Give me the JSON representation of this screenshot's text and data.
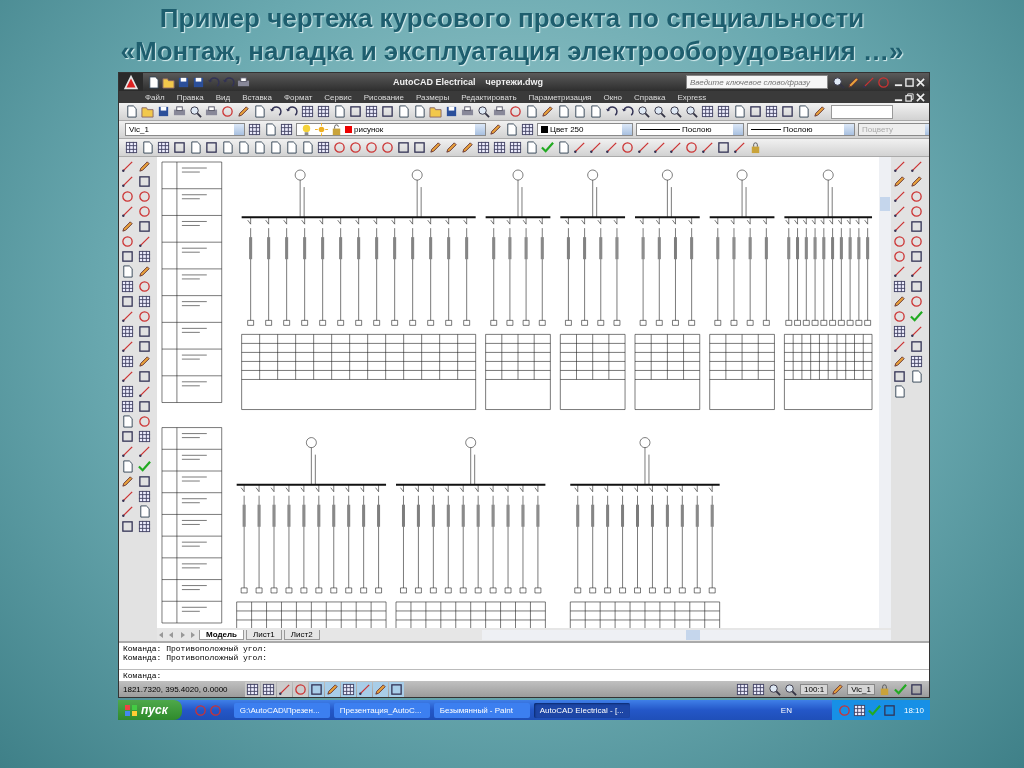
{
  "slide": {
    "title_lines": [
      "Пример чертежа курсового проекта по специальности",
      "«Монтаж, наладка и эксплуатация электрооборудования …»"
    ]
  },
  "window": {
    "app": "AutoCAD Electrical",
    "document": "чертежи.dwg",
    "search": {
      "placeholder": "Введите ключевое слово/фразу"
    }
  },
  "menu": [
    "Файл",
    "Правка",
    "Вид",
    "Вставка",
    "Формат",
    "Сервис",
    "Рисование",
    "Размеры",
    "Редактировать",
    "Параметризация",
    "Окно",
    "Справка",
    "Express"
  ],
  "layer_toolbar": {
    "view": "Vic_1",
    "layer": "рисунок",
    "color_setting": "Цвет 250",
    "linetype": "Послою",
    "lineweight": "Послою",
    "plotstyle": {
      "value": "Поцвету",
      "disabled": true
    }
  },
  "layout_tabs": [
    {
      "label": "Модель",
      "selected": true
    },
    {
      "label": "Лист1",
      "selected": false
    },
    {
      "label": "Лист2",
      "selected": false
    }
  ],
  "command_history": [
    "Команда: Противоположный угол:",
    "Команда: Противоположный угол:"
  ],
  "command_prompt": "Команда:",
  "status_bar": {
    "coordinates": "1821.7320, 395.4020, 0.0000",
    "toggles": [
      {
        "on": false
      },
      {
        "on": false
      },
      {
        "on": false
      },
      {
        "on": false
      },
      {
        "on": true
      },
      {
        "on": true
      },
      {
        "on": true
      },
      {
        "on": true
      },
      {
        "on": true
      },
      {
        "on": true
      }
    ],
    "scale": "100:1",
    "viewport": "Vic_1"
  },
  "taskbar": {
    "start": "пуск",
    "tasks": [
      {
        "label": "G:\\AutoCAD\\Презен...",
        "selected": false
      },
      {
        "label": "Презентация_AutoC...",
        "selected": false
      },
      {
        "label": "Безымянный - Paint",
        "selected": false
      },
      {
        "label": "AutoCAD Electrical - [...",
        "selected": true
      }
    ],
    "language": "EN",
    "clock": "18:10"
  }
}
